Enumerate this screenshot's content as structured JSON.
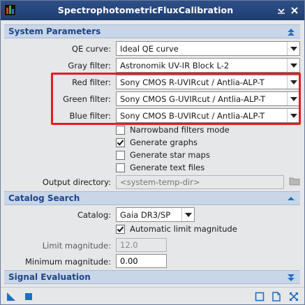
{
  "window": {
    "title": "SpectrophotometricFluxCalibration"
  },
  "titlebar_buttons": {
    "collapse": "⇲",
    "close": "×"
  },
  "sections": {
    "system": "System Parameters",
    "catalog": "Catalog Search",
    "signal": "Signal Evaluation"
  },
  "system": {
    "qe_curve": {
      "label": "QE curve:",
      "value": "Ideal QE curve"
    },
    "gray_filter": {
      "label": "Gray filter:",
      "value": "Astronomik UV-IR Block L-2"
    },
    "red_filter": {
      "label": "Red filter:",
      "value": "Sony CMOS R-UVIRcut / Antlia-ALP-T"
    },
    "green_filter": {
      "label": "Green filter:",
      "value": "Sony CMOS G-UVIRcut / Antlia-ALP-T"
    },
    "blue_filter": {
      "label": "Blue filter:",
      "value": "Sony CMOS B-UVIRcut / Antlia-ALP-T"
    },
    "checkboxes": [
      {
        "label": "Narrowband filters mode",
        "checked": false
      },
      {
        "label": "Generate graphs",
        "checked": true
      },
      {
        "label": "Generate star maps",
        "checked": false
      },
      {
        "label": "Generate text files",
        "checked": false
      }
    ],
    "output_directory": {
      "label": "Output directory:",
      "placeholder": "<system-temp-dir>"
    }
  },
  "catalog": {
    "catalog": {
      "label": "Catalog:",
      "value": "Gaia DR3/SP"
    },
    "auto_limit": {
      "label": "Automatic limit magnitude",
      "checked": true
    },
    "limit_magnitude": {
      "label": "Limit magnitude:",
      "value": "12.0"
    },
    "minimum_magnitude": {
      "label": "Minimum magnitude:",
      "value": "0.00"
    }
  },
  "colors": {
    "titlebar": "#24467d",
    "section_bg": "#c9d6e8",
    "section_text": "#1d4488",
    "highlight": "#e21d25",
    "accent_icon": "#1e6fc4"
  },
  "icons": {
    "app": "app-icon",
    "collapse": "collapse-icon",
    "close": "close-icon",
    "folder": "folder-icon",
    "new_instance": "new-instance-icon",
    "execute": "execute-icon",
    "reset": "reset-icon",
    "edit_instructions": "edit-instructions-icon",
    "preferences": "preferences-icon"
  }
}
